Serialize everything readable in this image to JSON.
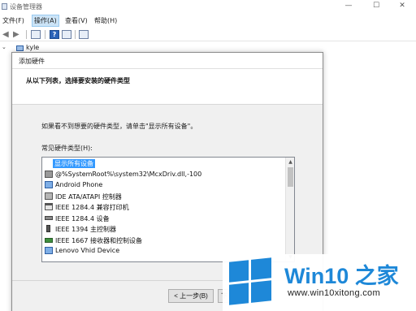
{
  "window": {
    "title": "设备管理器",
    "controls": {
      "minimize": "—",
      "maximize": "☐",
      "close": "✕"
    }
  },
  "menu": {
    "items": [
      "文件(F)",
      "操作(A)",
      "查看(V)",
      "帮助(H)"
    ],
    "active": "操作(A)"
  },
  "tree": {
    "root_label": "kyle",
    "expander": "⌄"
  },
  "toolbar": {
    "back_icon": "arrow-left-icon",
    "forward_icon": "arrow-right-icon",
    "help_label": "?"
  },
  "wizard": {
    "title": "添加硬件",
    "header": "从以下列表，选择要安装的硬件类型",
    "hint": "如果看不到想要的硬件类型，请单击\"显示所有设备\"。",
    "list_label": "常见硬件类型(H):",
    "items": [
      {
        "label": "显示所有设备",
        "icon": "gear-icon",
        "selected": true
      },
      {
        "label": "@%SystemRoot%\\system32\\McxDriv.dll,-100",
        "icon": "disk-icon",
        "selected": false
      },
      {
        "label": "Android Phone",
        "icon": "monitor-icon",
        "selected": false
      },
      {
        "label": "IDE ATA/ATAPI 控制器",
        "icon": "ide-controller-icon",
        "selected": false
      },
      {
        "label": "IEEE 1284.4 兼容打印机",
        "icon": "printer-icon",
        "selected": false
      },
      {
        "label": "IEEE 1284.4 设备",
        "icon": "port-icon",
        "selected": false
      },
      {
        "label": "IEEE 1394 主控制器",
        "icon": "usb-icon",
        "selected": false
      },
      {
        "label": "IEEE 1667 接收器和控制设备",
        "icon": "card-icon",
        "selected": false
      },
      {
        "label": "Lenovo Vhid Device",
        "icon": "monitor-icon",
        "selected": false
      }
    ],
    "buttons": {
      "back": "< 上一步(B)",
      "next": "下"
    }
  },
  "watermark": {
    "title": "Win10 之家",
    "url": "www.win10xitong.com",
    "color": "#1e88d8"
  }
}
